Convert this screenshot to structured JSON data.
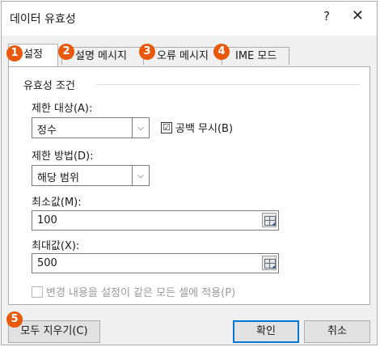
{
  "dialog": {
    "title": "데이터 유효성",
    "help_label": "?",
    "close_label": "✕"
  },
  "tabs": [
    {
      "label": "설정",
      "badge": "1",
      "active": true
    },
    {
      "label": "설명 메시지",
      "badge": "2",
      "active": false
    },
    {
      "label": "오류 메시지",
      "badge": "3",
      "active": false
    },
    {
      "label": "IME 모드",
      "badge": "4",
      "active": false
    }
  ],
  "criteria": {
    "group_label": "유효성 조건",
    "allow_label": "제한 대상(A):",
    "allow_value": "정수",
    "ignore_blank_label": "공백 무시(B)",
    "ignore_blank_checked": "☑",
    "data_label": "제한 방법(D):",
    "data_value": "해당 범위",
    "min_label": "최소값(M):",
    "min_value": "100",
    "max_label": "최대값(X):",
    "max_value": "500",
    "apply_all_label": "변경 내용을 설정이 같은 모든 셀에 적용(P)"
  },
  "footer": {
    "clear_all_label": "모두 지우기(C)",
    "clear_badge": "5",
    "ok_label": "확인",
    "cancel_label": "취소"
  },
  "colors": {
    "badge": "#e8590c",
    "focus": "#0078d7"
  }
}
